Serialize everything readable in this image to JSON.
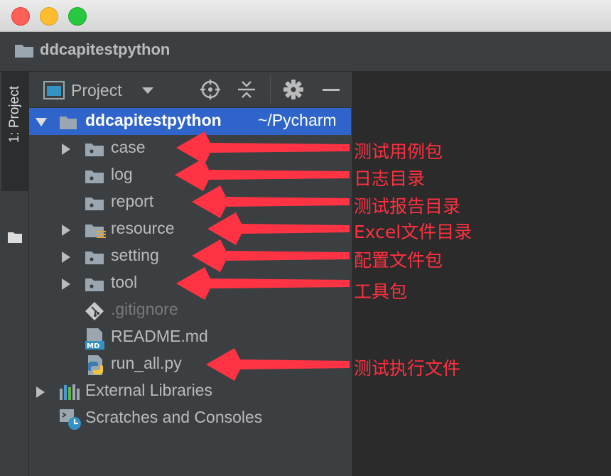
{
  "window": {
    "title": "ddcapitestpython"
  },
  "side_tab": {
    "label": "1: Project"
  },
  "panel": {
    "title": "Project"
  },
  "tree": {
    "root": {
      "name": "ddcapitestpython",
      "path": "~/Pycharm"
    },
    "items": [
      {
        "label": "case",
        "icon": "folder-icon"
      },
      {
        "label": "log",
        "icon": "folder-icon"
      },
      {
        "label": "report",
        "icon": "folder-icon"
      },
      {
        "label": "resource",
        "icon": "resource-folder-icon"
      },
      {
        "label": "setting",
        "icon": "folder-icon"
      },
      {
        "label": "tool",
        "icon": "folder-icon"
      },
      {
        "label": ".gitignore",
        "icon": "git-file-icon"
      },
      {
        "label": "README.md",
        "icon": "markdown-file-icon"
      },
      {
        "label": "run_all.py",
        "icon": "python-file-icon"
      },
      {
        "label": "External Libraries",
        "icon": "libraries-icon"
      },
      {
        "label": "Scratches and Consoles",
        "icon": "scratches-icon"
      }
    ]
  },
  "annotations": {
    "case": "测试用例包",
    "log": "日志目录",
    "report": "测试报告目录",
    "resource": "Excel文件目录",
    "setting": "配置文件包",
    "tool": "工具包",
    "run_all": "测试执行文件"
  },
  "colors": {
    "selection": "#2f65ca",
    "annotation": "#ff3040",
    "panel_bg": "#3c3f41",
    "editor_bg": "#2b2b2b"
  }
}
